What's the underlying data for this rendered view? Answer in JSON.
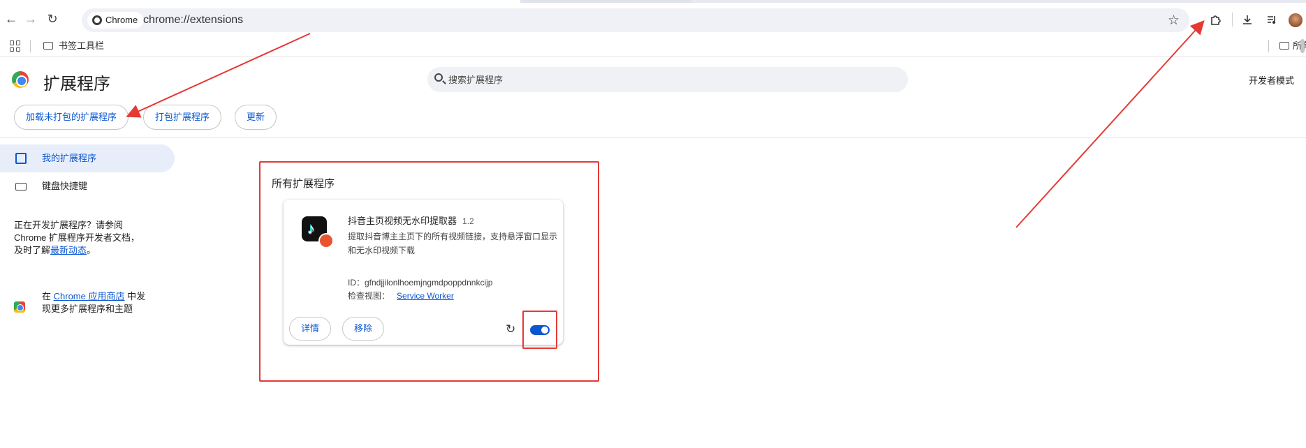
{
  "browser": {
    "chip_label": "Chrome",
    "url": "chrome://extensions",
    "bookmarks_folder": "书签工具栏",
    "right_bookmarks": "所有"
  },
  "header": {
    "title": "扩展程序",
    "search_placeholder": "搜索扩展程序",
    "dev_mode_label": "开发者模式"
  },
  "actions": {
    "load_unpacked": "加载未打包的扩展程序",
    "pack": "打包扩展程序",
    "update": "更新"
  },
  "sidebar": {
    "items": [
      {
        "label": "我的扩展程序"
      },
      {
        "label": "键盘快捷键"
      }
    ],
    "dev_text_1": "正在开发扩展程序？请参阅",
    "dev_text_2": "Chrome 扩展程序开发者文档，",
    "dev_text_3a": "及时了解",
    "dev_text_3_link": "最新动态",
    "dev_text_3b": "。",
    "store_prefix": "在 ",
    "store_link": "Chrome 应用商店",
    "store_suffix": " 中发",
    "store_line2": "现更多扩展程序和主题"
  },
  "main": {
    "section_title": "所有扩展程序",
    "extension": {
      "name": "抖音主页视频无水印提取器",
      "version": "1.2",
      "description": "提取抖音博主主页下的所有视频链接，支持悬浮窗口显示和无水印视频下载",
      "id_text": "ID：gfndjjilonlhoemjngmdpoppdnnkcijp",
      "inspect_label": "检查视图：",
      "inspect_link": "Service Worker",
      "details_button": "详情",
      "remove_button": "移除",
      "enabled": true
    }
  },
  "colors": {
    "accent": "#0b57d0",
    "annotation": "#e53935"
  }
}
